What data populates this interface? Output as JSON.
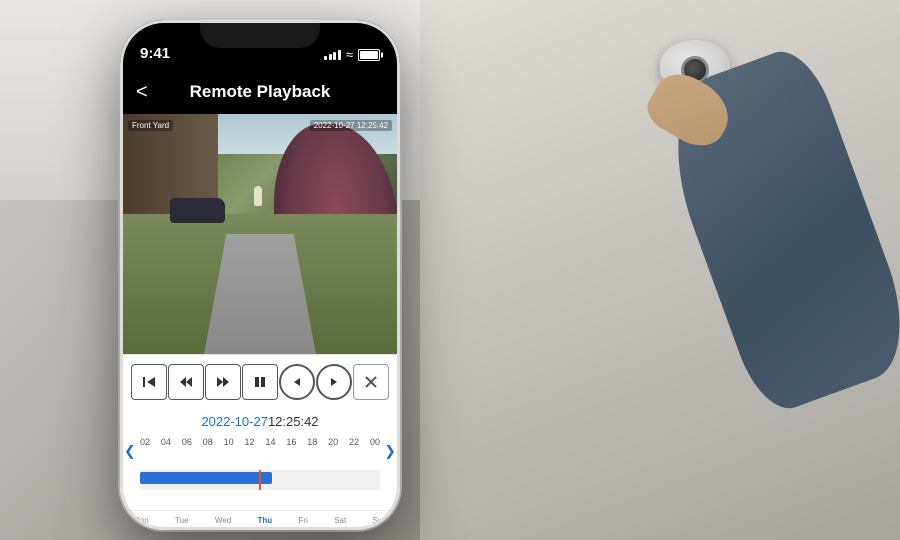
{
  "background": {
    "description": "Office/warehouse room with ceiling-mounted security camera and person installing it"
  },
  "phone": {
    "status_bar": {
      "time": "9:41",
      "battery_label": "100"
    },
    "nav": {
      "back_label": "<",
      "title": "Remote Playback"
    },
    "video": {
      "camera_label": "Front Yard",
      "timestamp": "2022-10-27 12:25:42"
    },
    "controls": [
      {
        "id": "skip-to-start",
        "symbol": "⏮",
        "label": "Skip to Start"
      },
      {
        "id": "rewind",
        "symbol": "⏪",
        "label": "Rewind"
      },
      {
        "id": "fast-forward",
        "symbol": "⏩",
        "label": "Fast Forward"
      },
      {
        "id": "pause",
        "symbol": "⏸",
        "label": "Pause"
      },
      {
        "id": "prev-segment",
        "symbol": "←",
        "label": "Previous Segment"
      },
      {
        "id": "next-segment",
        "symbol": "→",
        "label": "Next Segment"
      },
      {
        "id": "close",
        "symbol": "✕",
        "label": "Close"
      }
    ],
    "datetime": {
      "date": "2022-10-27",
      "time": " 12:25:42"
    },
    "timeline": {
      "labels": [
        "02",
        "04",
        "06",
        "08",
        "10",
        "12",
        "14",
        "16",
        "18",
        "20",
        "22",
        "00"
      ],
      "current_hour": "12",
      "bar_fill_percent": 55
    },
    "calendar": {
      "days": [
        {
          "label": "Mon",
          "active": false
        },
        {
          "label": "Tue",
          "active": false
        },
        {
          "label": "Wed",
          "active": false
        },
        {
          "label": "Thu",
          "active": false
        },
        {
          "label": "Fri",
          "active": false
        },
        {
          "label": "Sat",
          "active": false
        },
        {
          "label": "Sun",
          "active": false
        }
      ]
    }
  }
}
